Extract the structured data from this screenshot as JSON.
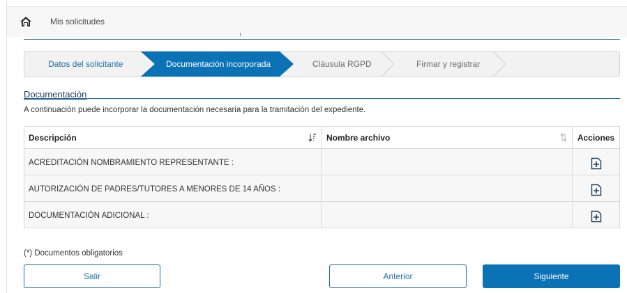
{
  "topbar": {
    "title": "Mis solicitudes",
    "icon": "home-icon"
  },
  "steps": [
    {
      "label": "Datos del solicitante",
      "state": "done"
    },
    {
      "label": "Documentación incorporada",
      "state": "active"
    },
    {
      "label": "Cláusula RGPD",
      "state": "pending"
    },
    {
      "label": "Firmar y registrar",
      "state": "pending"
    }
  ],
  "section": {
    "title": "Documentación",
    "intro": "A continuación puede incorporar la documentación necesaria para la tramitación del expediente."
  },
  "table": {
    "headers": {
      "description": "Descripción",
      "filename": "Nombre archivo",
      "actions": "Acciones"
    },
    "rows": [
      {
        "description": "ACREDITACIÓN NOMBRAMIENTO REPRESENTANTE :",
        "filename": ""
      },
      {
        "description": "AUTORIZACIÓN DE PADRES/TUTORES A MENORES DE 14 AÑOS :",
        "filename": ""
      },
      {
        "description": "DOCUMENTACIÓN ADICIONAL :",
        "filename": ""
      }
    ]
  },
  "note": "(*) Documentos obligatorios",
  "buttons": {
    "exit": "Salir",
    "previous": "Anterior",
    "next": "Siguiente"
  },
  "colors": {
    "accent": "#0b72b5",
    "link": "#1b6fa8",
    "heading": "#1b3d5e"
  }
}
